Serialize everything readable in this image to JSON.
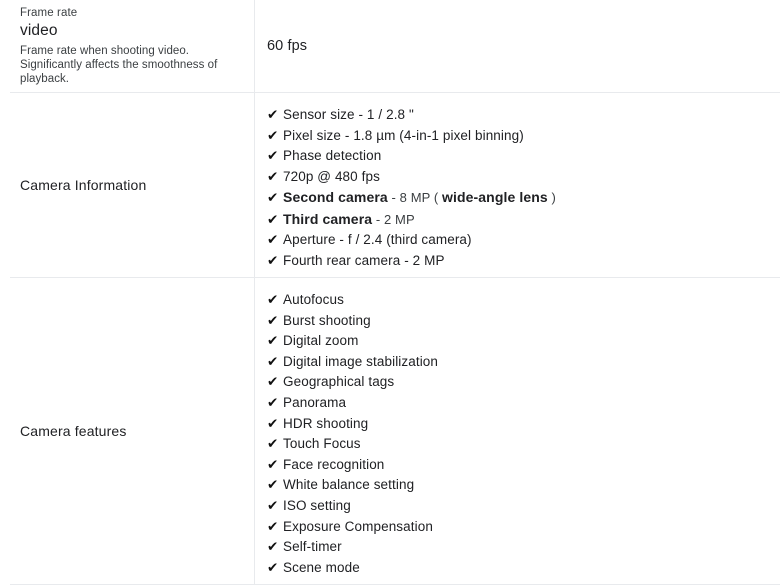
{
  "icons": {
    "check": "✔"
  },
  "rows": [
    {
      "id": "frame-rate-video",
      "kicker": "Frame rate",
      "title": "video",
      "description": "Frame rate when shooting video. Significantly affects the smoothness of playback.",
      "value": "60 fps"
    },
    {
      "id": "camera-information",
      "label": "Camera Information",
      "items": [
        {
          "parts": [
            {
              "text": "Sensor size - 1 / 2.8 \"",
              "style": "normal"
            }
          ]
        },
        {
          "parts": [
            {
              "text": "Pixel size - 1.8 µm (4-in-1 pixel binning)",
              "style": "normal"
            }
          ]
        },
        {
          "parts": [
            {
              "text": "Phase detection",
              "style": "normal"
            }
          ]
        },
        {
          "parts": [
            {
              "text": "720p @ 480 fps",
              "style": "normal"
            }
          ]
        },
        {
          "parts": [
            {
              "text": "Second camera",
              "style": "bold"
            },
            {
              "text": " - 8 MP ( ",
              "style": "light"
            },
            {
              "text": "wide-angle lens",
              "style": "bold"
            },
            {
              "text": " )",
              "style": "light"
            }
          ]
        },
        {
          "parts": [
            {
              "text": "Third camera",
              "style": "bold"
            },
            {
              "text": " - 2 MP",
              "style": "light"
            }
          ]
        },
        {
          "parts": [
            {
              "text": "Aperture - f / 2.4 (third camera)",
              "style": "normal"
            }
          ]
        },
        {
          "parts": [
            {
              "text": "Fourth rear camera - 2 MP",
              "style": "normal"
            }
          ]
        }
      ]
    },
    {
      "id": "camera-features",
      "label": "Camera features",
      "items": [
        {
          "parts": [
            {
              "text": "Autofocus",
              "style": "normal"
            }
          ]
        },
        {
          "parts": [
            {
              "text": "Burst shooting",
              "style": "normal"
            }
          ]
        },
        {
          "parts": [
            {
              "text": "Digital zoom",
              "style": "normal"
            }
          ]
        },
        {
          "parts": [
            {
              "text": "Digital image stabilization",
              "style": "normal"
            }
          ]
        },
        {
          "parts": [
            {
              "text": "Geographical tags",
              "style": "normal"
            }
          ]
        },
        {
          "parts": [
            {
              "text": "Panorama",
              "style": "normal"
            }
          ]
        },
        {
          "parts": [
            {
              "text": "HDR shooting",
              "style": "normal"
            }
          ]
        },
        {
          "parts": [
            {
              "text": "Touch Focus",
              "style": "normal"
            }
          ]
        },
        {
          "parts": [
            {
              "text": "Face recognition",
              "style": "normal"
            }
          ]
        },
        {
          "parts": [
            {
              "text": "White balance setting",
              "style": "normal"
            }
          ]
        },
        {
          "parts": [
            {
              "text": "ISO setting",
              "style": "normal"
            }
          ]
        },
        {
          "parts": [
            {
              "text": "Exposure Compensation",
              "style": "normal"
            }
          ]
        },
        {
          "parts": [
            {
              "text": "Self-timer",
              "style": "normal"
            }
          ]
        },
        {
          "parts": [
            {
              "text": "Scene mode",
              "style": "normal"
            }
          ]
        }
      ]
    }
  ]
}
